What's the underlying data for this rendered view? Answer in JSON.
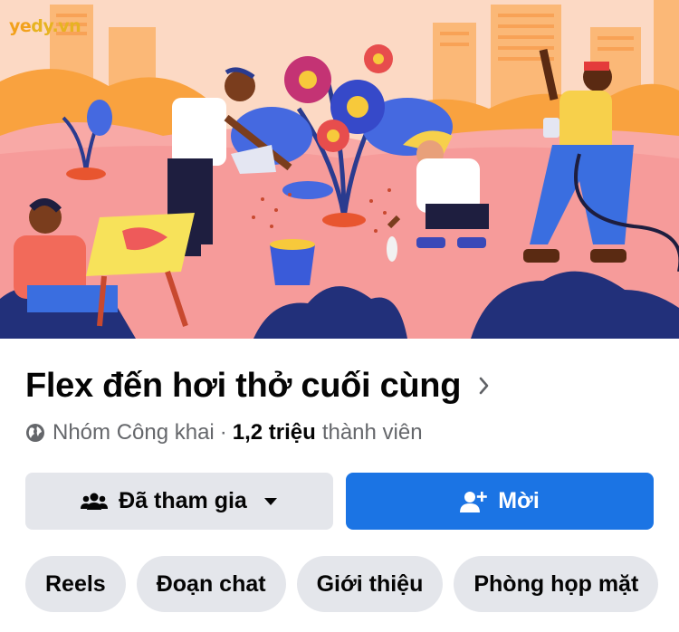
{
  "watermark": {
    "part1": "ye",
    "part2": "dy.vn"
  },
  "group": {
    "name": "Flex đến hơi thở cuối cùng",
    "privacy": "Nhóm Công khai",
    "separator": "·",
    "member_count": "1,2 triệu",
    "member_label": "thành viên"
  },
  "actions": {
    "joined_label": "Đã tham gia",
    "invite_label": "Mời"
  },
  "tabs": [
    {
      "label": "Reels"
    },
    {
      "label": "Đoạn chat"
    },
    {
      "label": "Giới thiệu"
    },
    {
      "label": "Phòng họp mặt"
    }
  ],
  "colors": {
    "primary": "#1b74e4",
    "secondary_button": "#e4e6eb",
    "text_primary": "#050505",
    "text_secondary": "#65676b"
  },
  "icons": {
    "privacy": "globe-icon",
    "title_chevron": "chevron-right-icon",
    "joined": "group-members-icon",
    "joined_dropdown": "caret-down-icon",
    "invite": "add-person-icon"
  }
}
